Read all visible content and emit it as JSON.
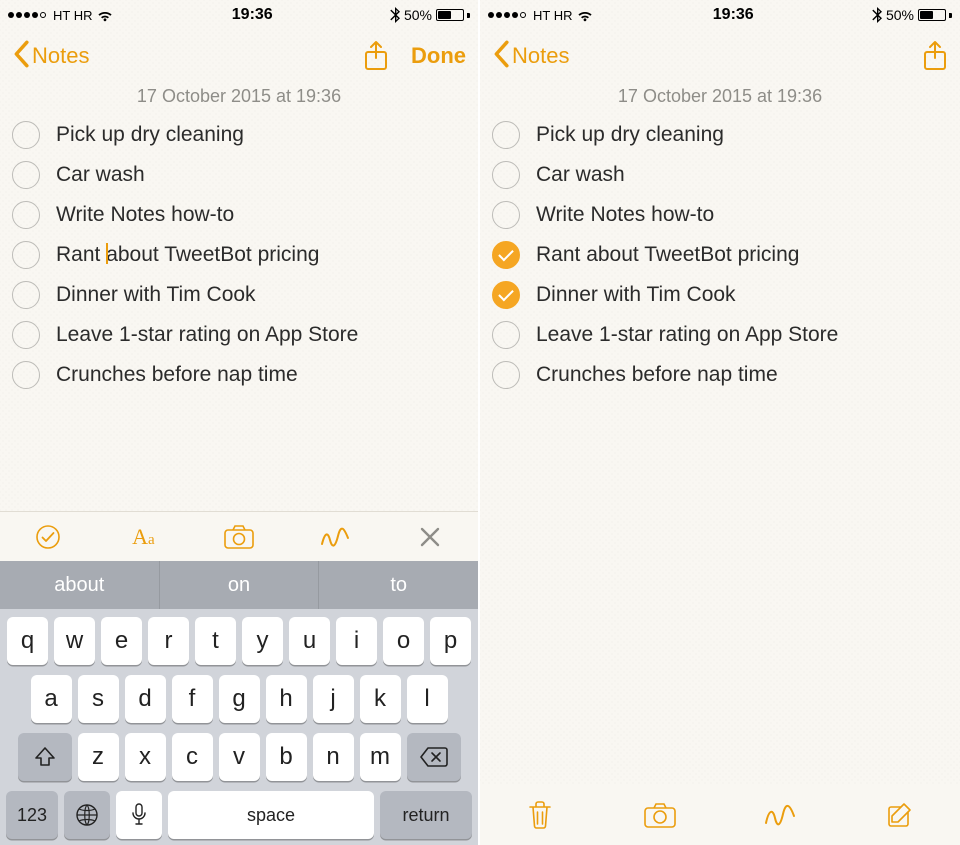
{
  "status": {
    "carrier": "HT HR",
    "time": "19:36",
    "battery_pct": "50%",
    "signal_filled": 4,
    "signal_total": 5
  },
  "nav": {
    "back_label": "Notes",
    "done_label": "Done"
  },
  "note": {
    "date_line": "17 October 2015 at 19:36"
  },
  "left": {
    "items": [
      {
        "text": "Pick up dry cleaning",
        "checked": false
      },
      {
        "text": "Car wash",
        "checked": false
      },
      {
        "text": "Write Notes how-to",
        "checked": false
      },
      {
        "text": "Rant about TweetBot pricing",
        "checked": false,
        "caret_after": "Rant "
      },
      {
        "text": "Dinner with Tim Cook",
        "checked": false
      },
      {
        "text": "Leave 1-star rating on App Store",
        "checked": false
      },
      {
        "text": "Crunches before nap time",
        "checked": false
      }
    ]
  },
  "right": {
    "items": [
      {
        "text": "Pick up dry cleaning",
        "checked": false
      },
      {
        "text": "Car wash",
        "checked": false
      },
      {
        "text": "Write Notes how-to",
        "checked": false
      },
      {
        "text": "Rant about TweetBot pricing",
        "checked": true
      },
      {
        "text": "Dinner with Tim Cook",
        "checked": true
      },
      {
        "text": "Leave 1-star rating on App Store",
        "checked": false
      },
      {
        "text": "Crunches before nap time",
        "checked": false
      }
    ]
  },
  "suggestions": [
    "about",
    "on",
    "to"
  ],
  "keyboard": {
    "row1": [
      "q",
      "w",
      "e",
      "r",
      "t",
      "y",
      "u",
      "i",
      "o",
      "p"
    ],
    "row2": [
      "a",
      "s",
      "d",
      "f",
      "g",
      "h",
      "j",
      "k",
      "l"
    ],
    "row3": [
      "z",
      "x",
      "c",
      "v",
      "b",
      "n",
      "m"
    ],
    "mode_key": "123",
    "space_label": "space",
    "return_label": "return"
  },
  "colors": {
    "accent": "#eb9d0d",
    "paper": "#f9f7f2"
  }
}
